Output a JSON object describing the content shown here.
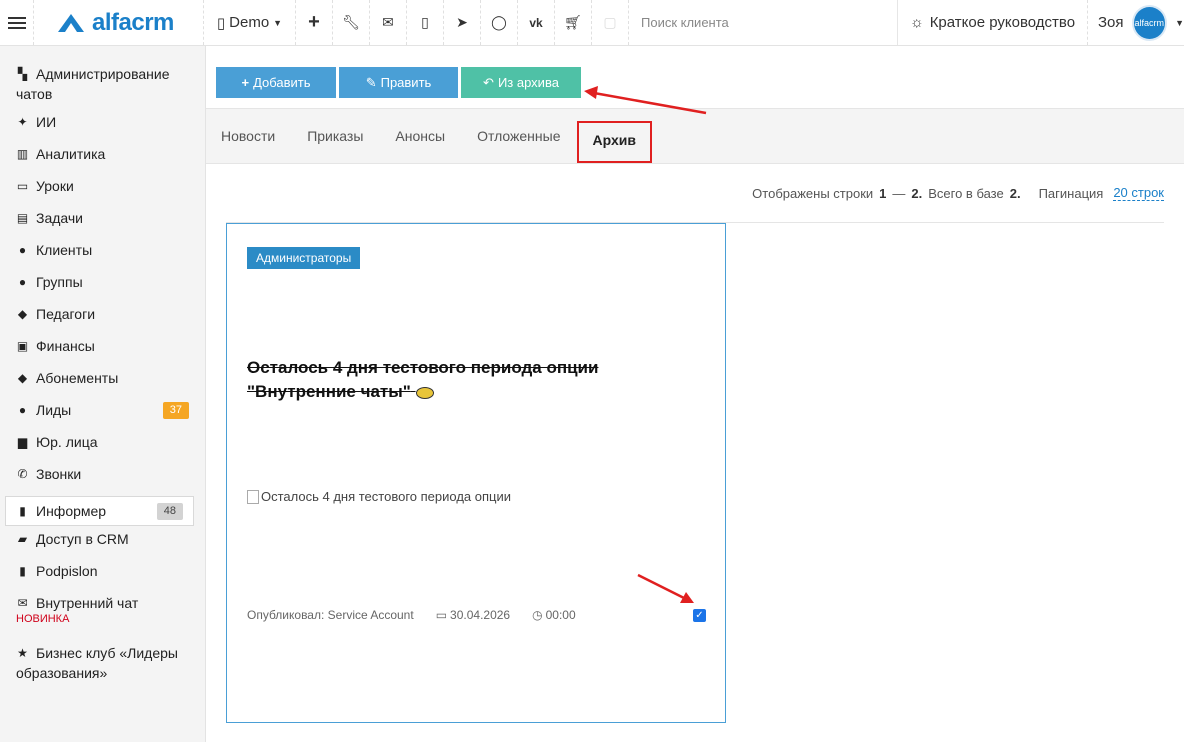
{
  "topbar": {
    "brand": "alfacrm",
    "branch": "Demo",
    "search_placeholder": "Поиск клиента",
    "guide": "Краткое руководство",
    "user_name": "Зоя",
    "avatar_text": "alfacrm"
  },
  "sidebar": {
    "items": [
      {
        "label": "Администрирование чатов",
        "icon": "chat-admin-icon"
      },
      {
        "label": "ИИ",
        "icon": "sparkle-icon"
      },
      {
        "label": "Аналитика",
        "icon": "map-icon"
      },
      {
        "label": "Уроки",
        "icon": "calendar-icon"
      },
      {
        "label": "Задачи",
        "icon": "clipboard-icon"
      },
      {
        "label": "Клиенты",
        "icon": "user-icon"
      },
      {
        "label": "Группы",
        "icon": "users-icon"
      },
      {
        "label": "Педагоги",
        "icon": "graduation-cap-icon"
      },
      {
        "label": "Финансы",
        "icon": "money-icon"
      },
      {
        "label": "Абонементы",
        "icon": "tag-icon"
      },
      {
        "label": "Лиды",
        "icon": "user-plus-icon",
        "badge": "37"
      },
      {
        "label": "Юр. лица",
        "icon": "briefcase-icon"
      },
      {
        "label": "Звонки",
        "icon": "phone-icon"
      },
      {
        "label": "Информер",
        "icon": "book-icon",
        "badge": "48"
      },
      {
        "label": "Доступ в CRM",
        "icon": "lock-icon"
      },
      {
        "label": "Podpislon",
        "icon": "file-icon"
      },
      {
        "label": "Внутренний чат",
        "icon": "envelope-icon",
        "sub": "НОВИНКА"
      },
      {
        "label": "Бизнес клуб «Лидеры образования»",
        "icon": "star-icon"
      }
    ]
  },
  "toolbar": {
    "add": "Добавить",
    "edit": "Править",
    "unarchive": "Из архива"
  },
  "tabs": [
    "Новости",
    "Приказы",
    "Анонсы",
    "Отложенные",
    "Архив"
  ],
  "info": {
    "prefix": "Отображены строки",
    "from": "1",
    "dash": "—",
    "to": "2.",
    "total_label": "Всего в базе",
    "total": "2.",
    "pagination_label": "Пагинация",
    "pagination_value": "20 строк"
  },
  "card": {
    "tag": "Администраторы",
    "title": "Осталось 4 дня тестового периода опции \"Внутренние чаты\"",
    "image_alt": "Осталось 4 дня тестового периода опции",
    "author": "Опубликовал: Service Account",
    "date": "30.04.2026",
    "time": "00:00",
    "checked": true
  }
}
